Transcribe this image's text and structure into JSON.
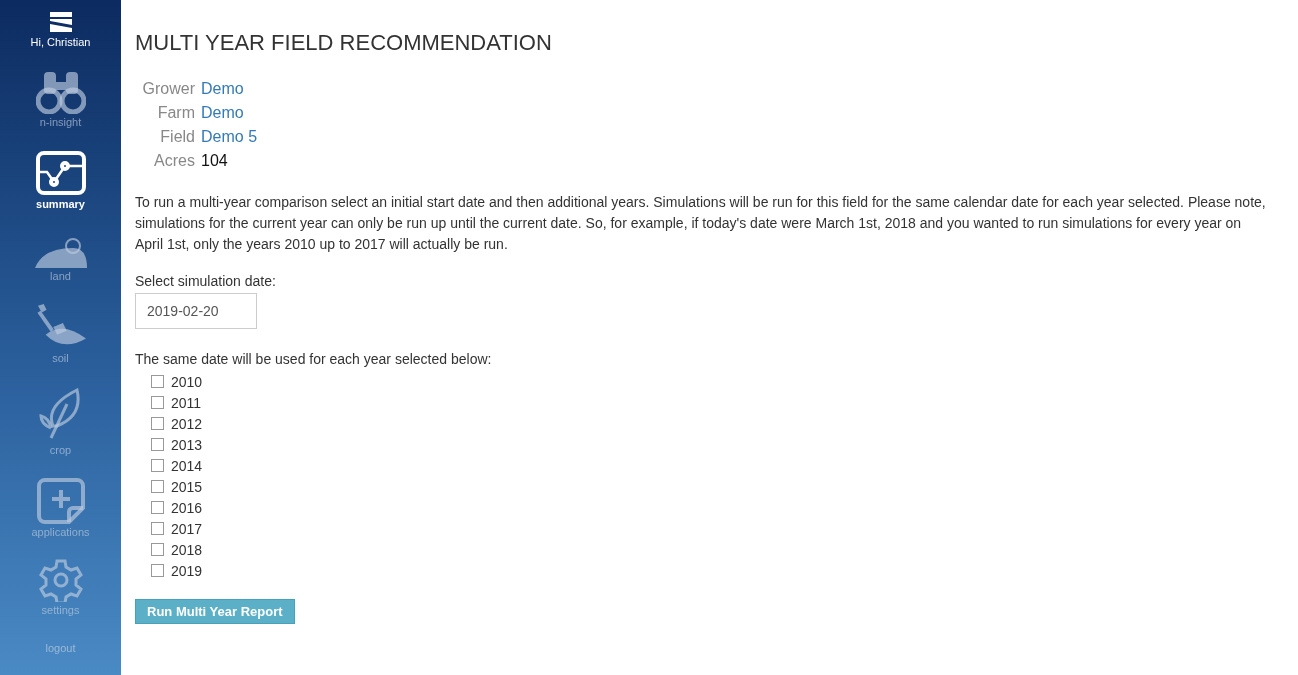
{
  "sidebar": {
    "greeting": "Hi, Christian",
    "items": [
      {
        "kind": "insight",
        "label": "n-insight",
        "selected": false
      },
      {
        "kind": "summary",
        "label": "summary",
        "selected": true
      },
      {
        "kind": "land",
        "label": "land",
        "selected": false
      },
      {
        "kind": "soil",
        "label": "soil",
        "selected": false
      },
      {
        "kind": "crop",
        "label": "crop",
        "selected": false
      },
      {
        "kind": "applications",
        "label": "applications",
        "selected": false
      },
      {
        "kind": "settings",
        "label": "settings",
        "selected": false
      }
    ],
    "logout": "logout"
  },
  "title": "MULTI YEAR FIELD RECOMMENDATION",
  "details": [
    {
      "label": "Grower",
      "value": "Demo",
      "link": true
    },
    {
      "label": "Farm",
      "value": "Demo",
      "link": true
    },
    {
      "label": "Field",
      "value": "Demo 5",
      "link": true
    },
    {
      "label": "Acres",
      "value": "104",
      "link": false
    }
  ],
  "description": "To run a multi-year comparison select an initial start date and then additional years. Simulations will be run for this field for the same calendar date for each year selected. Please note, simulations for the current year can only be run up until the current date. So, for example, if today's date were March 1st, 2018 and you wanted to run simulations for every year on April 1st, only the years 2010 up to 2017 will actually be run.",
  "date_label": "Select simulation date:",
  "date_value": "2019-02-20",
  "years_label": "The same date will be used for each year selected below:",
  "years": [
    {
      "label": "2010",
      "checked": false
    },
    {
      "label": "2011",
      "checked": false
    },
    {
      "label": "2012",
      "checked": false
    },
    {
      "label": "2013",
      "checked": false
    },
    {
      "label": "2014",
      "checked": false
    },
    {
      "label": "2015",
      "checked": false
    },
    {
      "label": "2016",
      "checked": false
    },
    {
      "label": "2017",
      "checked": false
    },
    {
      "label": "2018",
      "checked": false
    },
    {
      "label": "2019",
      "checked": false
    }
  ],
  "run_button": "Run Multi Year Report"
}
